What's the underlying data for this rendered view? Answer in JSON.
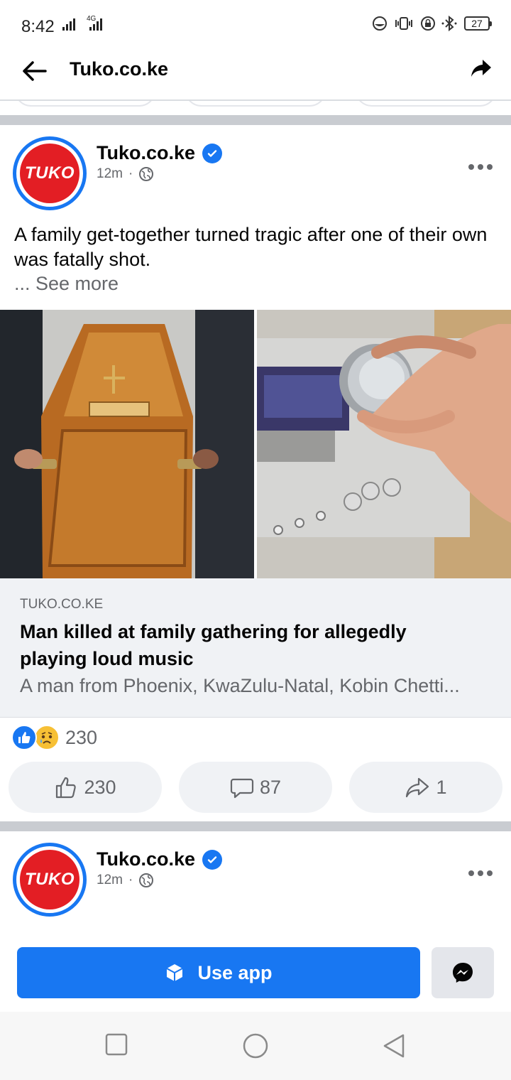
{
  "status_bar": {
    "time": "8:42",
    "network": "4G",
    "battery": "27"
  },
  "header": {
    "title": "Tuko.co.ke",
    "back_icon": "arrow-left-icon",
    "share_icon": "share-arrow-icon"
  },
  "posts": [
    {
      "author": "Tuko.co.ke",
      "avatar_text": "TUKO",
      "time": "12m",
      "dot": "·",
      "text": "A family get-together turned tragic after one of their own was fatally shot.",
      "see_more": "... See more",
      "link": {
        "domain": "TUKO.CO.KE",
        "title": "Man killed at family gathering for allegedly playing loud music",
        "description": "A man from Phoenix, KwaZulu-Natal, Kobin Chetti..."
      },
      "reactions_count": "230",
      "actions": {
        "like": "230",
        "comment": "87",
        "share": "1"
      }
    },
    {
      "author": "Tuko.co.ke",
      "avatar_text": "TUKO",
      "time": "12m",
      "dot": "·"
    }
  ],
  "cta": {
    "label": "Use app"
  },
  "colors": {
    "accent": "#1877f2",
    "brand_red": "#e31e24",
    "muted_text": "#65676b",
    "separator": "#c9ccd1"
  }
}
